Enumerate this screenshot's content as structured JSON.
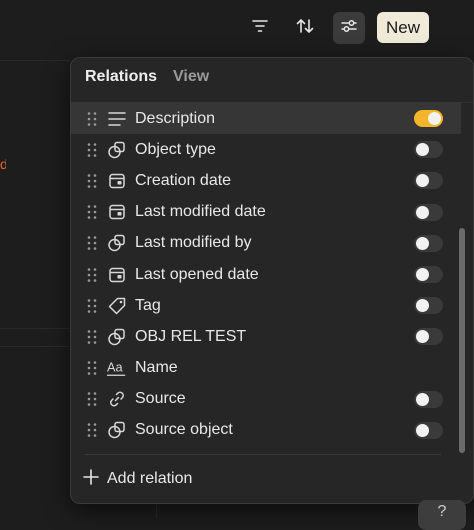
{
  "toolbar": {
    "filter_icon": "filter-icon",
    "sort_icon": "sort-icon",
    "settings_icon": "sliders-icon",
    "new_label": "New"
  },
  "panel": {
    "tabs": [
      {
        "label": "Relations",
        "active": true
      },
      {
        "label": "View",
        "active": false
      }
    ],
    "relations": [
      {
        "label": "Description",
        "icon": "text-lines-icon",
        "toggle": true,
        "on": true
      },
      {
        "label": "Object type",
        "icon": "object-shapes-icon",
        "toggle": true,
        "on": false
      },
      {
        "label": "Creation date",
        "icon": "calendar-icon",
        "toggle": true,
        "on": false
      },
      {
        "label": "Last modified date",
        "icon": "calendar-icon",
        "toggle": true,
        "on": false
      },
      {
        "label": "Last modified by",
        "icon": "object-shapes-icon",
        "toggle": true,
        "on": false
      },
      {
        "label": "Last opened date",
        "icon": "calendar-icon",
        "toggle": true,
        "on": false
      },
      {
        "label": "Tag",
        "icon": "tag-icon",
        "toggle": true,
        "on": false
      },
      {
        "label": "OBJ REL TEST",
        "icon": "object-shapes-icon",
        "toggle": true,
        "on": false
      },
      {
        "label": "Name",
        "icon": "name-aa-icon",
        "toggle": false,
        "on": false
      },
      {
        "label": "Source",
        "icon": "link-icon",
        "toggle": true,
        "on": false
      },
      {
        "label": "Source object",
        "icon": "object-shapes-icon",
        "toggle": true,
        "on": false
      }
    ],
    "add_relation_label": "Add relation"
  },
  "help_label": "?",
  "colors": {
    "accent_toggle": "#f5b52a",
    "new_button_bg": "#f0ead8",
    "background": "#1d1d1d",
    "panel_bg": "#262626"
  }
}
